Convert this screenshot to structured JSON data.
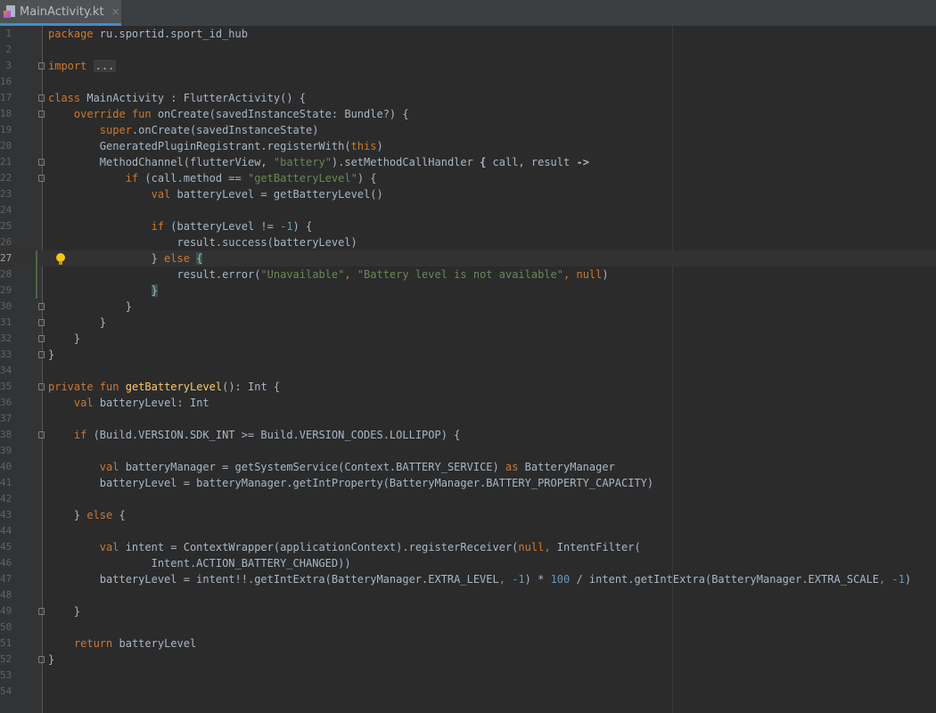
{
  "tab": {
    "title": "MainActivity.kt",
    "close": "×"
  },
  "lines": [
    {
      "num": "1",
      "parts": [
        [
          "k",
          "package"
        ],
        [
          "t",
          " ru.sportid.sport_id_hub"
        ]
      ]
    },
    {
      "num": "2",
      "parts": []
    },
    {
      "num": "3",
      "fold": true,
      "parts": [
        [
          "k",
          "import"
        ],
        [
          "t",
          " "
        ],
        [
          "fold",
          "..."
        ]
      ]
    },
    {
      "num": "16",
      "parts": []
    },
    {
      "num": "17",
      "fold": true,
      "parts": [
        [
          "k",
          "class"
        ],
        [
          "t",
          " MainActivity : FlutterActivity() {"
        ]
      ]
    },
    {
      "num": "18",
      "fold": true,
      "parts": [
        [
          "t",
          "    "
        ],
        [
          "k",
          "override fun"
        ],
        [
          "t",
          " onCreate(savedInstanceState: Bundle?) {"
        ]
      ]
    },
    {
      "num": "19",
      "parts": [
        [
          "t",
          "        "
        ],
        [
          "k",
          "super"
        ],
        [
          "t",
          ".onCreate(savedInstanceState)"
        ]
      ]
    },
    {
      "num": "20",
      "parts": [
        [
          "t",
          "        GeneratedPluginRegistrant.registerWith("
        ],
        [
          "k",
          "this"
        ],
        [
          "t",
          ")"
        ]
      ]
    },
    {
      "num": "21",
      "fold": true,
      "parts": [
        [
          "t",
          "        MethodChannel(flutterView, "
        ],
        [
          "s",
          "\"battery\""
        ],
        [
          "t",
          ").setMethodCallHandler "
        ],
        [
          "b",
          "{"
        ],
        [
          "t",
          " call, result "
        ],
        [
          "b",
          "->"
        ]
      ]
    },
    {
      "num": "22",
      "fold": true,
      "parts": [
        [
          "t",
          "            "
        ],
        [
          "k",
          "if"
        ],
        [
          "t",
          " (call.method == "
        ],
        [
          "s",
          "\"getBatteryLevel\""
        ],
        [
          "t",
          ") {"
        ]
      ]
    },
    {
      "num": "23",
      "parts": [
        [
          "t",
          "                "
        ],
        [
          "k",
          "val"
        ],
        [
          "t",
          " batteryLevel = getBatteryLevel()"
        ]
      ]
    },
    {
      "num": "24",
      "parts": []
    },
    {
      "num": "25",
      "parts": [
        [
          "t",
          "                "
        ],
        [
          "k",
          "if"
        ],
        [
          "t",
          " (batteryLevel != "
        ],
        [
          "n",
          "-1"
        ],
        [
          "t",
          ") {"
        ]
      ]
    },
    {
      "num": "26",
      "parts": [
        [
          "t",
          "                    result.success(batteryLevel)"
        ]
      ]
    },
    {
      "num": "27",
      "current": true,
      "bulb": true,
      "changed": true,
      "parts": [
        [
          "t",
          "                } "
        ],
        [
          "k",
          "else"
        ],
        [
          "t",
          " "
        ],
        [
          "hl",
          "{"
        ]
      ]
    },
    {
      "num": "28",
      "changed": true,
      "parts": [
        [
          "t",
          "                    result.error("
        ],
        [
          "s",
          "\"Unavailable\""
        ],
        [
          "k",
          ","
        ],
        [
          "t",
          " "
        ],
        [
          "s",
          "\"Battery level is not available\""
        ],
        [
          "k",
          ","
        ],
        [
          "t",
          " "
        ],
        [
          "k",
          "null"
        ],
        [
          "t",
          ")"
        ]
      ]
    },
    {
      "num": "29",
      "changed": true,
      "parts": [
        [
          "t",
          "                "
        ],
        [
          "hl",
          "}"
        ]
      ]
    },
    {
      "num": "30",
      "fold": true,
      "parts": [
        [
          "t",
          "            }"
        ]
      ]
    },
    {
      "num": "31",
      "fold": true,
      "parts": [
        [
          "t",
          "        }"
        ]
      ]
    },
    {
      "num": "32",
      "fold": true,
      "parts": [
        [
          "t",
          "    }"
        ]
      ]
    },
    {
      "num": "33",
      "fold": true,
      "parts": [
        [
          "t",
          "}"
        ]
      ]
    },
    {
      "num": "34",
      "parts": []
    },
    {
      "num": "35",
      "fold": true,
      "parts": [
        [
          "k",
          "private fun"
        ],
        [
          "t",
          " "
        ],
        [
          "f",
          "getBatteryLevel"
        ],
        [
          "t",
          "(): Int {"
        ]
      ]
    },
    {
      "num": "36",
      "parts": [
        [
          "t",
          "    "
        ],
        [
          "k",
          "val"
        ],
        [
          "t",
          " batteryLevel: Int"
        ]
      ]
    },
    {
      "num": "37",
      "parts": []
    },
    {
      "num": "38",
      "fold": true,
      "parts": [
        [
          "t",
          "    "
        ],
        [
          "k",
          "if"
        ],
        [
          "t",
          " (Build.VERSION.SDK_INT >= Build.VERSION_CODES.LOLLIPOP) {"
        ]
      ]
    },
    {
      "num": "39",
      "parts": []
    },
    {
      "num": "40",
      "parts": [
        [
          "t",
          "        "
        ],
        [
          "k",
          "val"
        ],
        [
          "t",
          " batteryManager = getSystemService(Context.BATTERY_SERVICE) "
        ],
        [
          "k",
          "as"
        ],
        [
          "t",
          " BatteryManager"
        ]
      ]
    },
    {
      "num": "41",
      "parts": [
        [
          "t",
          "        batteryLevel = batteryManager.getIntProperty(BatteryManager.BATTERY_PROPERTY_CAPACITY)"
        ]
      ]
    },
    {
      "num": "42",
      "parts": []
    },
    {
      "num": "43",
      "parts": [
        [
          "t",
          "    } "
        ],
        [
          "k",
          "else"
        ],
        [
          "t",
          " {"
        ]
      ]
    },
    {
      "num": "44",
      "parts": []
    },
    {
      "num": "45",
      "parts": [
        [
          "t",
          "        "
        ],
        [
          "k",
          "val"
        ],
        [
          "t",
          " intent = ContextWrapper(applicationContext).registerReceiver("
        ],
        [
          "k",
          "null"
        ],
        [
          "k",
          ","
        ],
        [
          "t",
          " IntentFilter("
        ]
      ]
    },
    {
      "num": "46",
      "parts": [
        [
          "t",
          "                Intent.ACTION_BATTERY_CHANGED))"
        ]
      ]
    },
    {
      "num": "47",
      "parts": [
        [
          "t",
          "        batteryLevel = intent!!.getIntExtra(BatteryManager.EXTRA_LEVEL"
        ],
        [
          "k",
          ","
        ],
        [
          "t",
          " "
        ],
        [
          "n",
          "-1"
        ],
        [
          "t",
          ") * "
        ],
        [
          "n",
          "100"
        ],
        [
          "t",
          " / intent.getIntExtra(BatteryManager.EXTRA_SCALE"
        ],
        [
          "k",
          ","
        ],
        [
          "t",
          " "
        ],
        [
          "n",
          "-1"
        ],
        [
          "t",
          ")"
        ]
      ]
    },
    {
      "num": "48",
      "parts": []
    },
    {
      "num": "49",
      "fold": true,
      "parts": [
        [
          "t",
          "    }"
        ]
      ]
    },
    {
      "num": "50",
      "parts": []
    },
    {
      "num": "51",
      "parts": [
        [
          "t",
          "    "
        ],
        [
          "k",
          "return"
        ],
        [
          "t",
          " batteryLevel"
        ]
      ]
    },
    {
      "num": "52",
      "fold": true,
      "parts": [
        [
          "t",
          "}"
        ]
      ]
    },
    {
      "num": "53",
      "parts": []
    },
    {
      "num": "54",
      "parts": []
    }
  ],
  "colors": {
    "background": "#2b2b2b",
    "keyword": "#cc7832",
    "string": "#6a8759",
    "number": "#6897bb",
    "function": "#ffc66d",
    "text": "#a9b7c6"
  },
  "icons": {
    "tab": "kotlin-file-icon",
    "bulb": "lightbulb-icon"
  }
}
